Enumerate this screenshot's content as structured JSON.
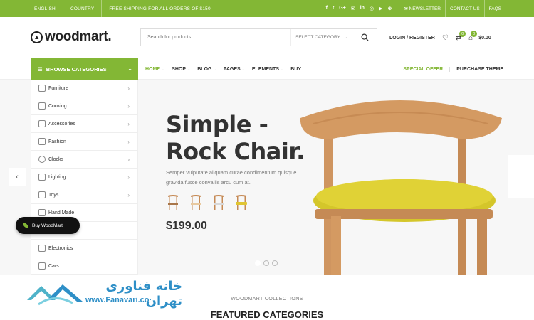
{
  "topbar": {
    "language": "ENGLISH",
    "country": "COUNTRY",
    "shipping": "FREE SHIPPING FOR ALL ORDERS OF $150",
    "social": [
      "f",
      "t",
      "G+",
      "✉",
      "in",
      "◎",
      "▶",
      "⊕"
    ],
    "newsletter": "NEWSLETTER",
    "contact": "CONTACT US",
    "faqs": "FAQS"
  },
  "header": {
    "logo": "woodmart.",
    "search_placeholder": "Search for products",
    "select_category": "SELECT CATEGORY",
    "login": "LOGIN / REGISTER",
    "compare_count": "0",
    "cart_count": "0",
    "cart_total": "$0.00"
  },
  "nav": {
    "browse": "BROWSE CATEGORIES",
    "items": [
      {
        "label": "HOME",
        "arrow": "⌄"
      },
      {
        "label": "SHOP",
        "arrow": "⌄"
      },
      {
        "label": "BLOG",
        "arrow": "⌄"
      },
      {
        "label": "PAGES",
        "arrow": "⌄"
      },
      {
        "label": "ELEMENTS",
        "arrow": "⌄"
      },
      {
        "label": "BUY",
        "arrow": ""
      }
    ],
    "special": "SPECIAL OFFER",
    "purchase": "PURCHASE THEME"
  },
  "categories": [
    "Furniture",
    "Cooking",
    "Accessories",
    "Fashion",
    "Clocks",
    "Lighting",
    "Toys",
    "Hand Made",
    "",
    "Electronics",
    "Cars"
  ],
  "hero": {
    "title_line1": "Simple -",
    "title_line2": "Rock Chair.",
    "description": "Semper vulputate aliquam curae condimentum quisque gravida fusce convallis arcu cum at.",
    "price": "$199.00",
    "buy_button": "Buy WoodMart"
  },
  "watermark": {
    "persian": "خانه فناوری تهران",
    "url": "www.Fanavari.co"
  },
  "section": {
    "subtitle": "WOODMART COLLECTIONS",
    "title": "FEATURED CATEGORIES"
  },
  "colors": {
    "brand": "#83b735",
    "seat": "#d4c62a",
    "wood": "#d49a62"
  }
}
